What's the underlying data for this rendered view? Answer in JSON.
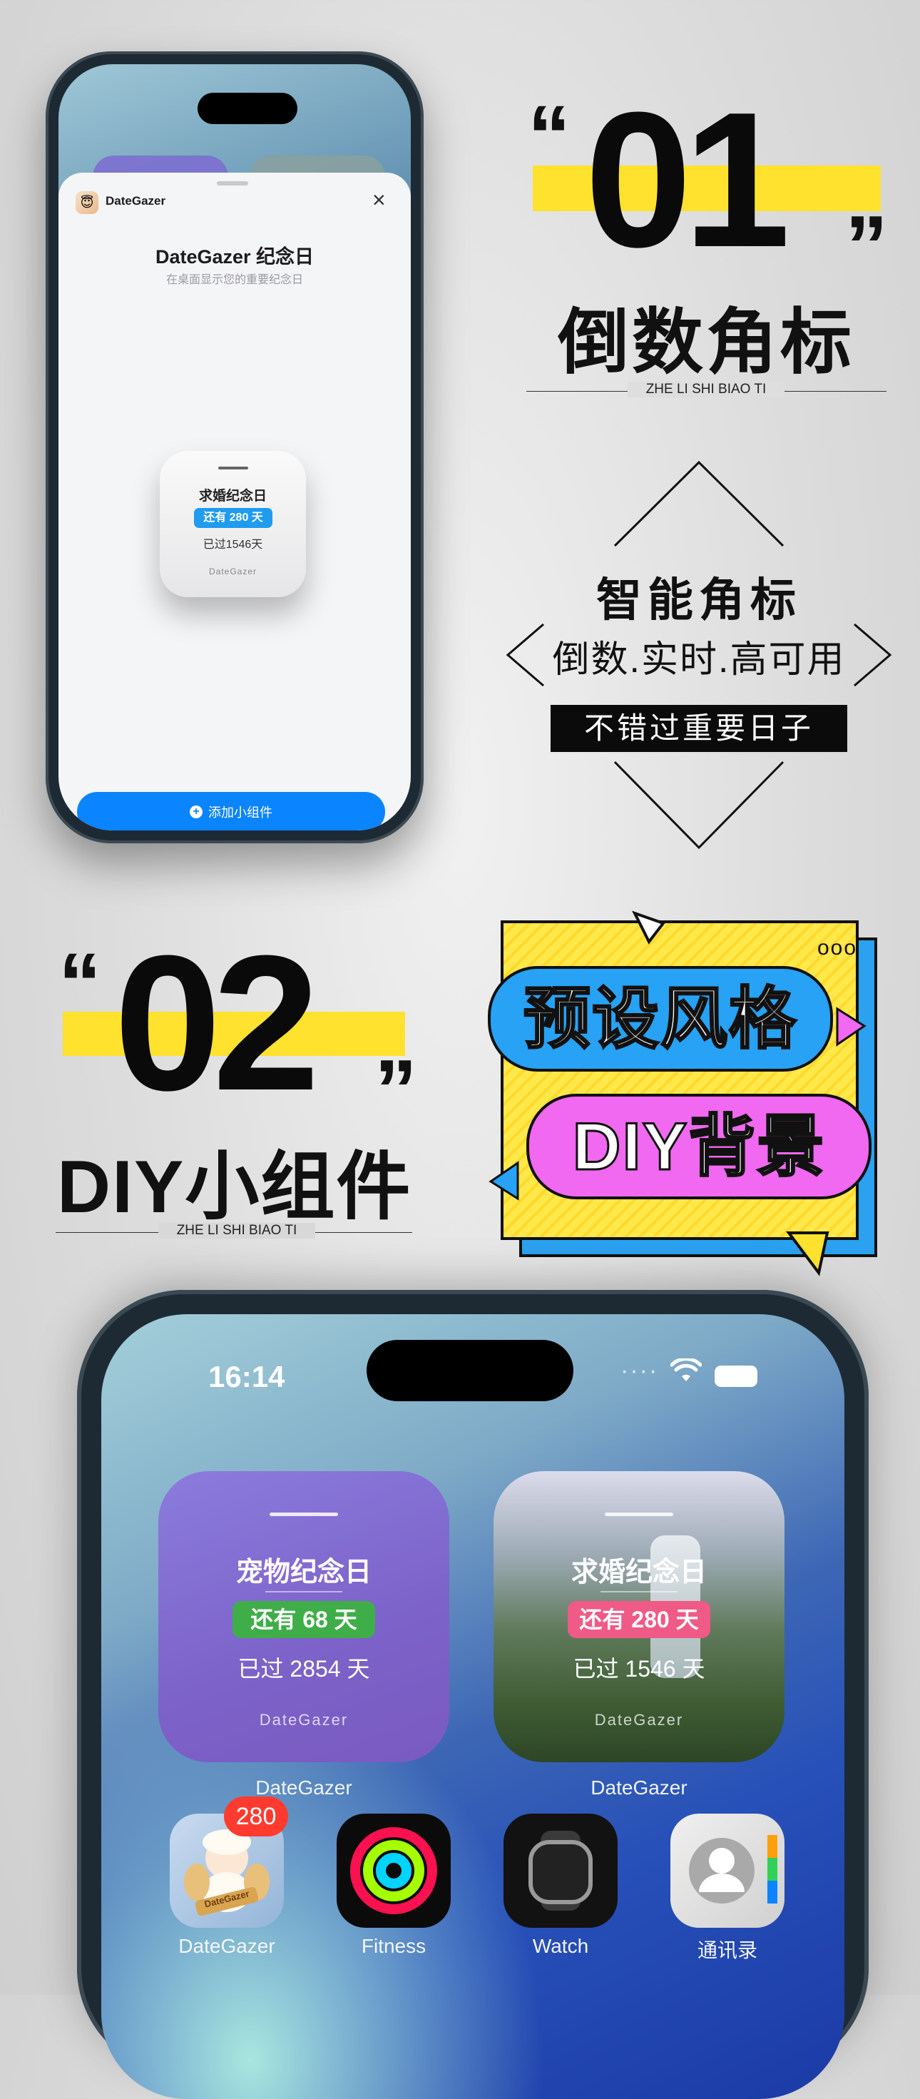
{
  "section1": {
    "number": "01",
    "quote_open": "“",
    "quote_close": "”",
    "title": "倒数角标",
    "subtitle": "ZHE LI SHI BIAO TI",
    "smart_title": "智能角标",
    "smart_subtitle": "倒数.实时.高可用",
    "band_text": "不错过重要日子"
  },
  "section2": {
    "number": "02",
    "quote_open": "“",
    "quote_close": "”",
    "title": "DIY小组件",
    "subtitle": "ZHE LI SHI BIAO TI",
    "comic_dots": "ooo",
    "pill1": "预设风格",
    "pill2": "DIY背景"
  },
  "phone1": {
    "app_name": "DateGazer",
    "sheet_title": "DateGazer 纪念日",
    "sheet_subtitle": "在桌面显示您的重要纪念日",
    "widget": {
      "title": "求婚纪念日",
      "badge": "还有 280 天",
      "passed": "已过1546天",
      "brand": "DateGazer"
    },
    "add_button": "添加小组件"
  },
  "phone2": {
    "time": "16:14",
    "widget1": {
      "title": "宠物纪念日",
      "badge": "还有 68 天",
      "passed": "已过 2854 天",
      "brand": "DateGazer",
      "label": "DateGazer"
    },
    "widget2": {
      "title": "求婚纪念日",
      "badge": "还有 280 天",
      "passed": "已过 1546 天",
      "brand": "DateGazer",
      "label": "DateGazer"
    },
    "apps": [
      {
        "label": "DateGazer",
        "badge": "280",
        "icon_text": "DateGazer"
      },
      {
        "label": "Fitness"
      },
      {
        "label": "Watch"
      },
      {
        "label": "通讯录"
      }
    ]
  },
  "colors": {
    "highlight": "#ffe22e",
    "blue_pill": "#27a2f5",
    "pink_pill": "#f069f0",
    "accent_blue": "#0a84ff",
    "green_badge": "#3fae49",
    "pink_badge": "#ef5a86"
  }
}
